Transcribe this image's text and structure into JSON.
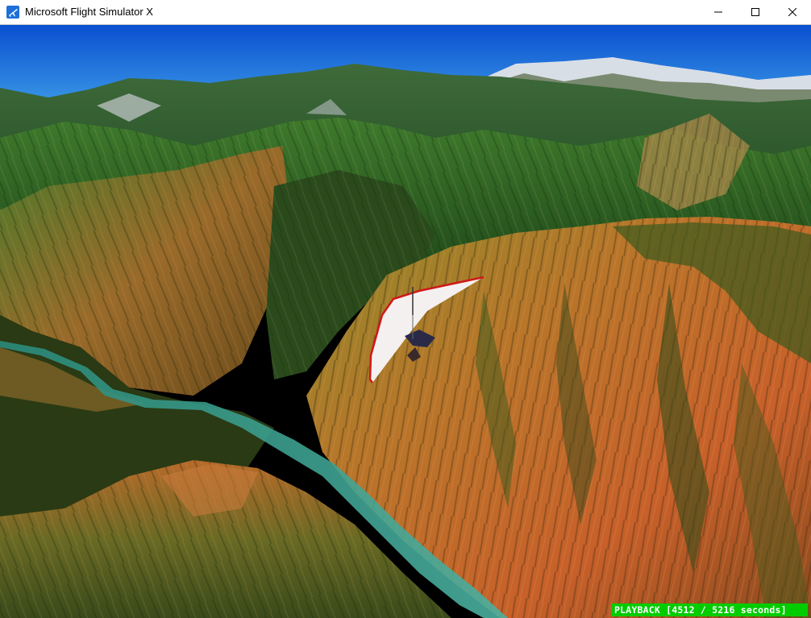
{
  "window": {
    "title": "Microsoft Flight Simulator X",
    "app_icon": "airplane-icon",
    "controls": {
      "minimize_icon": "minimize-icon",
      "maximize_icon": "maximize-icon",
      "close_icon": "close-icon"
    }
  },
  "scene": {
    "description_icon": "mountain-landscape",
    "aircraft_icon": "hang-glider-icon"
  },
  "hud": {
    "playback_text": "PLAYBACK [4512 / 5216 seconds]"
  },
  "colors": {
    "sky_top": "#0a4fd0",
    "sky_bottom": "#3a9ae8",
    "playback_bg": "#00cc00",
    "playback_fg": "#ffffff"
  }
}
